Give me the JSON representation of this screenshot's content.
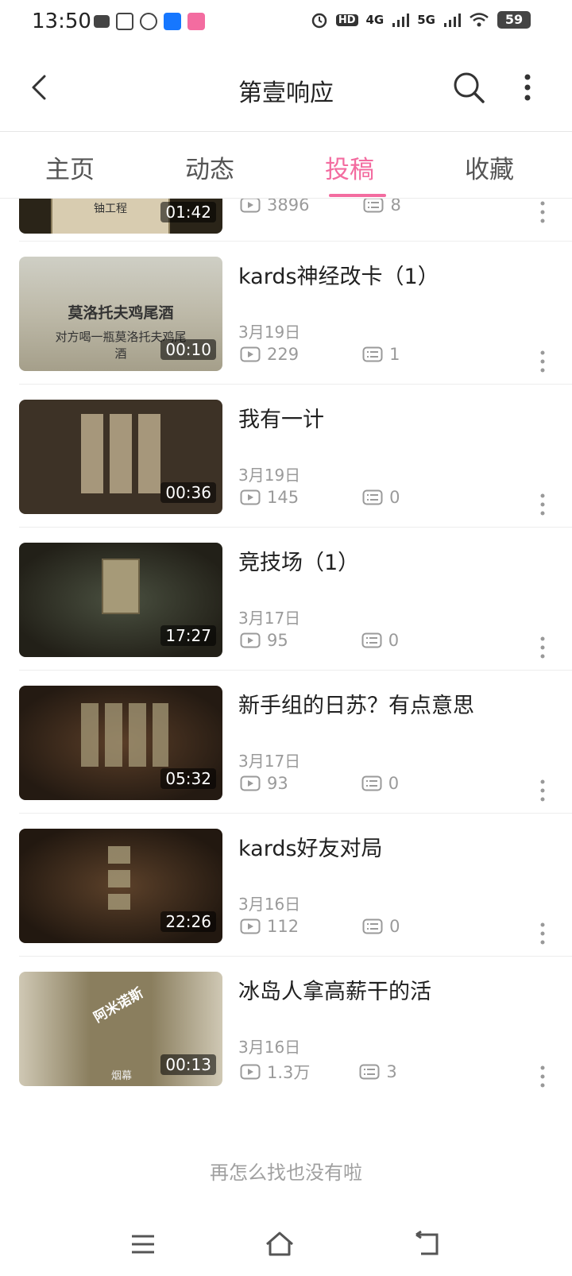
{
  "status_bar": {
    "time": "13:50",
    "network_4g": "4G",
    "network_5g": "5G",
    "battery": "59"
  },
  "header": {
    "title": "第壹响应"
  },
  "tabs": [
    {
      "label": "主页"
    },
    {
      "label": "动态"
    },
    {
      "label": "投稿"
    },
    {
      "label": "收藏"
    }
  ],
  "videos": [
    {
      "thumb_text": "铀工程",
      "duration": "01:42",
      "title": "",
      "date": "",
      "views": "3896",
      "comments": "8"
    },
    {
      "thumb_text": "莫洛托夫鸡尾酒",
      "thumb_subtext": "对方喝一瓶莫洛托夫鸡尾酒",
      "duration": "00:10",
      "title": "kards神经改卡（1）",
      "date": "3月19日",
      "views": "229",
      "comments": "1"
    },
    {
      "duration": "00:36",
      "title": "我有一计",
      "date": "3月19日",
      "views": "145",
      "comments": "0"
    },
    {
      "duration": "17:27",
      "title": "竞技场（1）",
      "date": "3月17日",
      "views": "95",
      "comments": "0"
    },
    {
      "duration": "05:32",
      "title": "新手组的日苏？有点意思",
      "date": "3月17日",
      "views": "93",
      "comments": "0"
    },
    {
      "duration": "22:26",
      "title": "kards好友对局",
      "date": "3月16日",
      "views": "112",
      "comments": "0"
    },
    {
      "thumb_text": "阿米诺斯",
      "thumb_subtext": "烟幕",
      "duration": "00:13",
      "title": "冰岛人拿高薪干的活",
      "date": "3月16日",
      "views": "1.3万",
      "comments": "3"
    }
  ],
  "end_text": "再怎么找也没有啦",
  "colors": {
    "accent": "#f36ca0",
    "secondary_text": "#9a9a9a"
  }
}
